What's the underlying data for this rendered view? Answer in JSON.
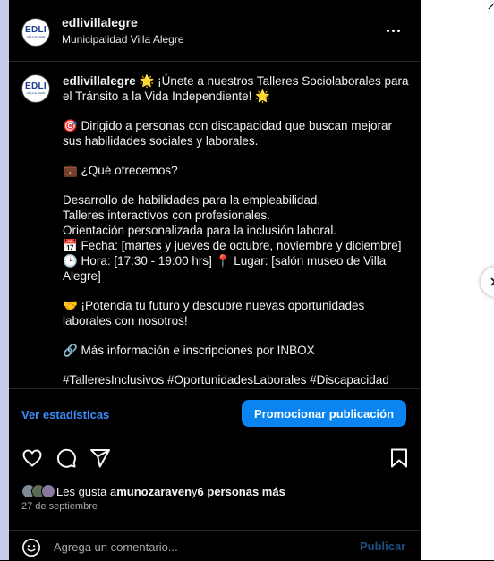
{
  "colors": {
    "accent": "#0a84f0",
    "link": "#3b8dfb",
    "background": "#000000",
    "muted": "#a8a8a8"
  },
  "post": {
    "header": {
      "username": "edlivillalegre",
      "location": "Municipalidad Villa Alegre",
      "avatar_text": "EDLI",
      "avatar_subtext": "VILLA ALEGRE",
      "more_icon": "more-horizontal-icon"
    },
    "caption": {
      "username": "edlivillalegre",
      "lines": [
        " 🌟 ¡Únete a nuestros Talleres Sociolaborales para el Tránsito a la Vida Independiente! 🌟",
        "🎯 Dirigido a personas con discapacidad que buscan mejorar sus habilidades sociales y laborales.",
        "💼 ¿Qué ofrecemos?",
        "Desarrollo de habilidades para la empleabilidad.",
        "Talleres interactivos con profesionales.",
        "Orientación personalizada para la inclusión laboral.",
        "📅 Fecha: [martes y jueves de octubre, noviembre y diciembre] 🕒 Hora: [17:30 - 19:00 hrs] 📍 Lugar: [salón museo de Villa Alegre]",
        "🤝 ¡Potencia tu futuro y descubre nuevas oportunidades laborales con nosotros!",
        "🔗 Más información e inscripciones por INBOX",
        "#TalleresInclusivos #OportunidadesLaborales #Discapacidad"
      ]
    },
    "stats_link": "Ver estadísticas",
    "promote_button": "Promocionar publicación",
    "likes": {
      "prefix": "Les gusta a ",
      "user": "munozaraven",
      "middle": " y ",
      "others": "6 personas más"
    },
    "date": "27 de septiembre",
    "comment": {
      "placeholder": "Agrega un comentario...",
      "publish": "Publicar"
    }
  }
}
